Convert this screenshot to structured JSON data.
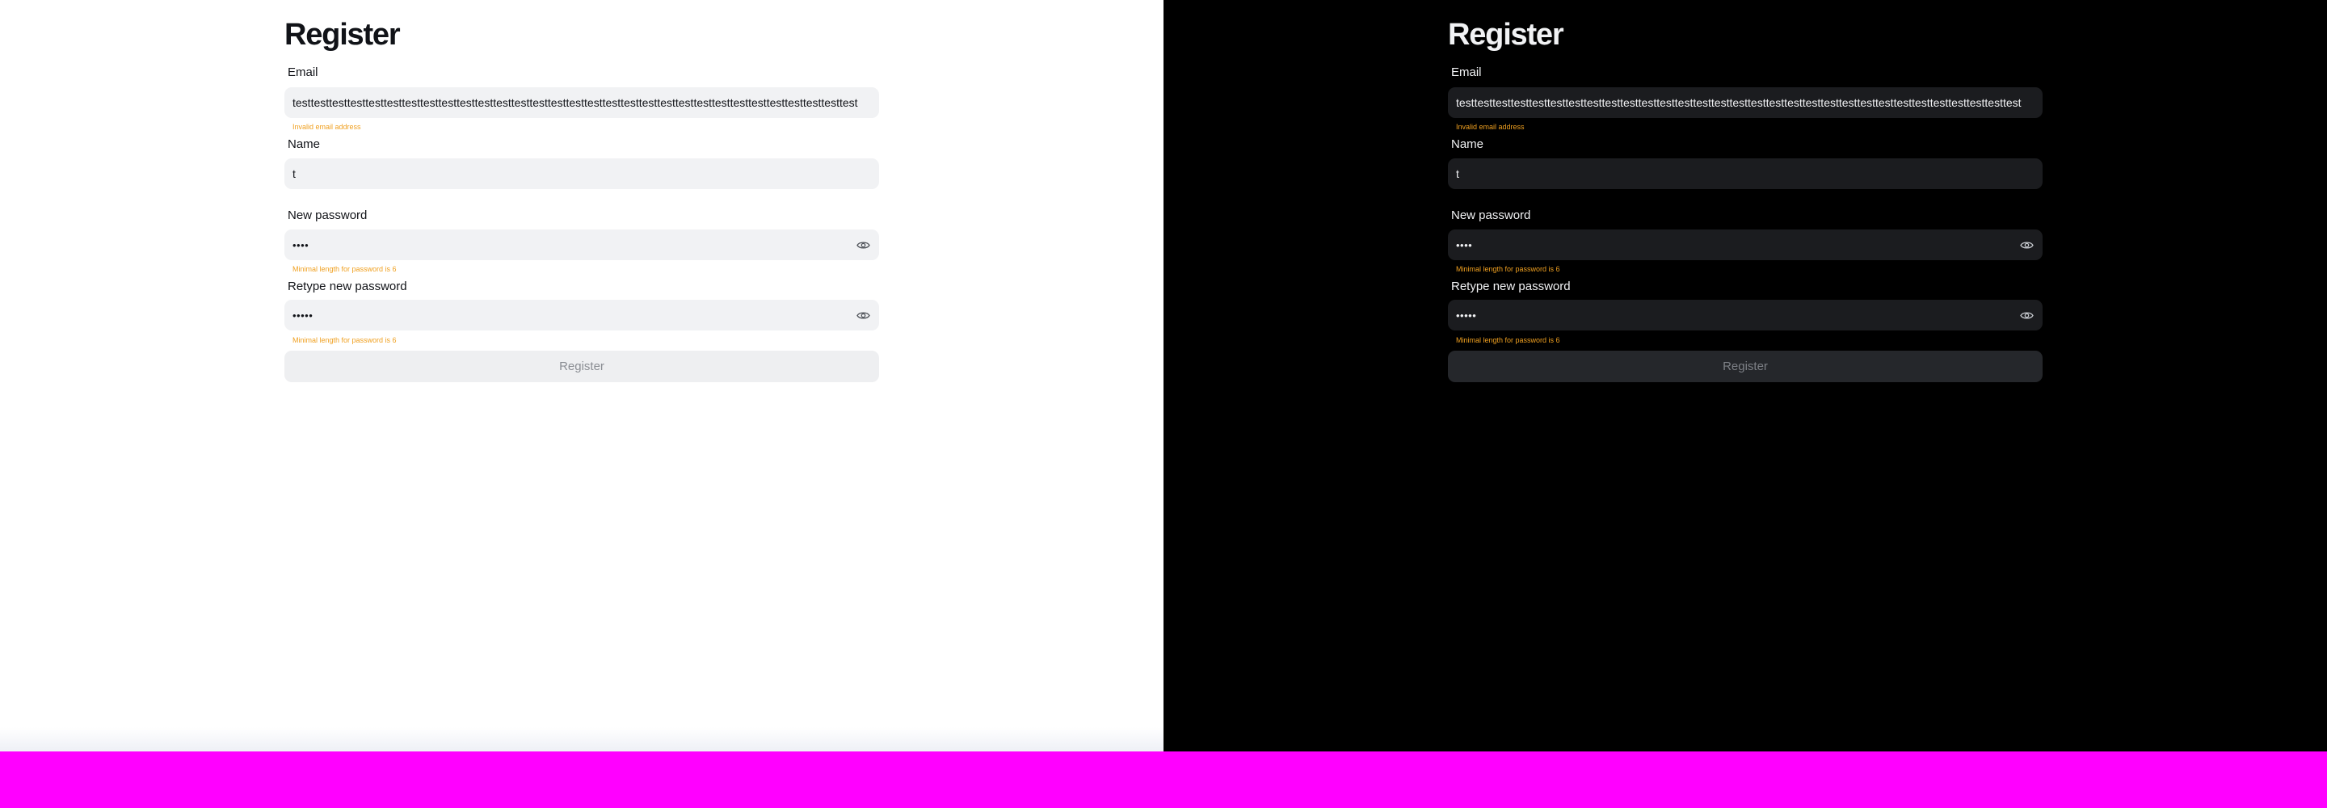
{
  "light": {
    "title": "Register",
    "email": {
      "label": "Email",
      "value": "testtesttesttesttesttesttesttesttesttesttesttesttesttesttesttesttesttesttesttesttesttesttesttesttesttesttesttesttesttesttest",
      "error": "Invalid email address"
    },
    "name": {
      "label": "Name",
      "value": "t"
    },
    "new_password": {
      "label": "New password",
      "value": "••••",
      "error": "Minimal length for password is 6"
    },
    "retype_password": {
      "label": "Retype new password",
      "value": "•••••",
      "error": "Minimal length for password is 6"
    },
    "submit_label": "Register"
  },
  "dark": {
    "title": "Register",
    "email": {
      "label": "Email",
      "value": "testtesttesttesttesttesttesttesttesttesttesttesttesttesttesttesttesttesttesttesttesttesttesttesttesttesttesttesttesttesttest",
      "error": "Invalid email address"
    },
    "name": {
      "label": "Name",
      "value": "t"
    },
    "new_password": {
      "label": "New password",
      "value": "••••",
      "error": "Minimal length for password is 6"
    },
    "retype_password": {
      "label": "Retype new password",
      "value": "•••••",
      "error": "Minimal length for password is 6"
    },
    "submit_label": "Register"
  },
  "icons": {
    "password_toggle": "eye-icon"
  },
  "colors": {
    "error": "#f0a020",
    "overflow_area": "#ff00ff",
    "light_background": "#ffffff",
    "dark_background": "#000000"
  }
}
